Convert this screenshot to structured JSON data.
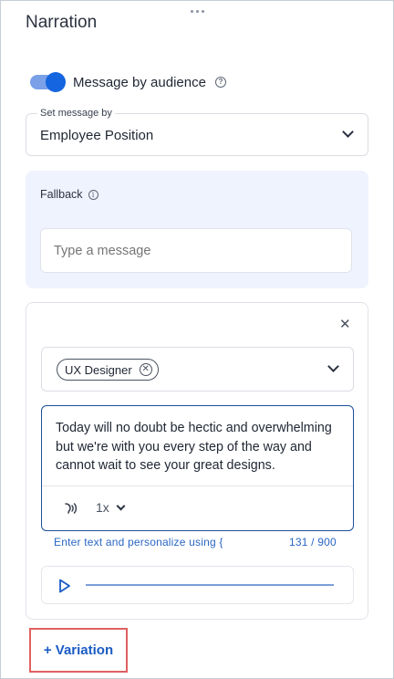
{
  "panel": {
    "title": "Narration"
  },
  "audience_toggle": {
    "label": "Message by audience",
    "enabled": true,
    "help_icon": "question-circle-icon"
  },
  "set_message_by": {
    "label": "Set message by",
    "value": "Employee Position"
  },
  "fallback": {
    "label": "Fallback",
    "info_icon": "info-circle-icon",
    "input_placeholder": "Type a message",
    "input_value": ""
  },
  "variation": {
    "close_icon": "close-icon",
    "selected_tags": [
      "UX Designer"
    ],
    "message": "Today will no doubt be hectic and overwhelming but we're with you every step of the way and cannot wait to see your great designs.",
    "voice_icon": "voice-icon",
    "speed": "1x",
    "hint": "Enter text and personalize using {",
    "char_count": "131 / 900",
    "play_icon": "play-icon",
    "playback_progress": 0
  },
  "add_variation_label": "+ Variation",
  "colors": {
    "primary": "#1565e0",
    "link": "#2a66c4",
    "fallback_bg": "#eef3fd",
    "highlight_border": "#e06060"
  }
}
